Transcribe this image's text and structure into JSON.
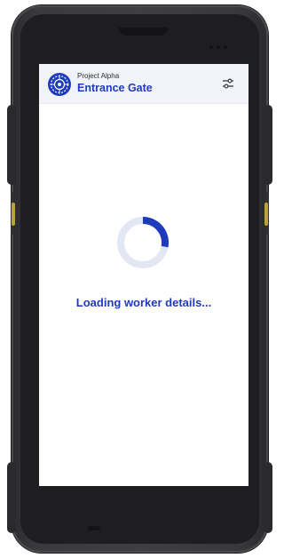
{
  "header": {
    "project_name": "Project Alpha",
    "gate_name": "Entrance Gate",
    "logo_icon": "project-logo-icon",
    "settings_icon": "sliders-icon"
  },
  "main": {
    "loading_text": "Loading worker details...",
    "spinner_progress": 0.28
  },
  "colors": {
    "accent": "#1f3bbd",
    "spinner_track": "#e3e7f3",
    "header_bg": "#f2f3f8"
  }
}
